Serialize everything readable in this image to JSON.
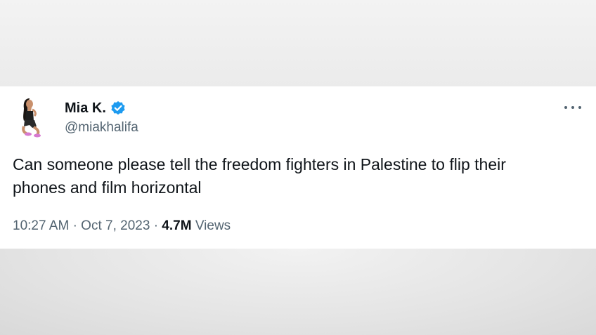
{
  "tweet": {
    "display_name": "Mia K.",
    "handle": "@miakhalifa",
    "verified_icon": "verified-badge-icon",
    "more_icon": "more-options-icon",
    "text_line1": "Can someone please tell the freedom fighters in Palestine to flip their",
    "text_line2": "phones and film horizontal",
    "time": "10:27 AM",
    "separator": "·",
    "date": "Oct 7, 2023",
    "views_count": "4.7M",
    "views_label": "Views"
  },
  "colors": {
    "verified_blue": "#1d9bf0",
    "secondary_text": "#536471",
    "primary_text": "#0f1419"
  }
}
